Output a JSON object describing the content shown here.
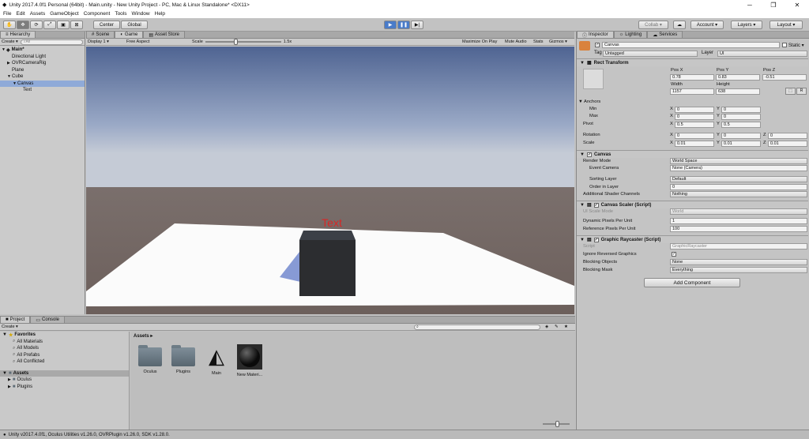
{
  "window": {
    "title": "Unity 2017.4.0f1 Personal (64bit) - Main.unity - New Unity Project - PC, Mac & Linux Standalone* <DX11>",
    "min": "─",
    "max": "❐",
    "close": "✕"
  },
  "menu": [
    "File",
    "Edit",
    "Assets",
    "GameObject",
    "Component",
    "Tools",
    "Window",
    "Help"
  ],
  "toolbar": {
    "center": "Center",
    "global": "Global",
    "collab": "Collab ▾",
    "account": "Account ▾",
    "layers": "Layers ▾",
    "layout": "Layout ▾"
  },
  "hierarchy": {
    "tab": "Hierarchy",
    "create": "Create ▾",
    "search_placeholder": "All",
    "items": [
      {
        "label": "Main*",
        "indent": 0,
        "arrow": "▼"
      },
      {
        "label": "Directional Light",
        "indent": 1,
        "arrow": ""
      },
      {
        "label": "OVRCameraRig",
        "indent": 1,
        "arrow": "▶"
      },
      {
        "label": "Plane",
        "indent": 1,
        "arrow": ""
      },
      {
        "label": "Cube",
        "indent": 1,
        "arrow": "▼"
      },
      {
        "label": "Canvas",
        "indent": 2,
        "arrow": "▼"
      },
      {
        "label": "Text",
        "indent": 3,
        "arrow": ""
      }
    ]
  },
  "views": {
    "tabs": [
      "Scene",
      "Game",
      "Asset Store"
    ],
    "display": "Display 1 ▾",
    "aspect": "Free Aspect",
    "scale_label": "Scale",
    "scale_value": "1.5x",
    "maximize": "Maximize On Play",
    "mute": "Mute Audio",
    "stats": "Stats",
    "gizmos": "Gizmos ▾",
    "world_text": "Text"
  },
  "inspector": {
    "tabs": [
      "Inspector",
      "Lighting",
      "Services"
    ],
    "object_name": "Canvas",
    "static_label": "Static ▾",
    "tag_label": "Tag",
    "tag_value": "Untagged",
    "layer_label": "Layer",
    "layer_value": "UI",
    "rect_transform": {
      "title": "Rect Transform",
      "posx_label": "Pos X",
      "posy_label": "Pos Y",
      "posz_label": "Pos Z",
      "posx": "0.78",
      "posy": "0.83",
      "posz": "-0.51",
      "width_label": "Width",
      "height_label": "Height",
      "width": "1157",
      "height": "638",
      "anchors": "Anchors",
      "min": "Min",
      "max": "Max",
      "min_x": "0",
      "min_y": "0",
      "max_x": "0",
      "max_y": "0",
      "pivot": "Pivot",
      "pivot_x": "0.5",
      "pivot_y": "0.5",
      "rotation": "Rotation",
      "rot_x": "0",
      "rot_y": "0",
      "rot_z": "0",
      "scale": "Scale",
      "scale_x": "0.01",
      "scale_y": "0.01",
      "scale_z": "0.01",
      "x": "X",
      "y": "Y",
      "z": "Z",
      "r": "R"
    },
    "canvas": {
      "title": "Canvas",
      "render_mode_label": "Render Mode",
      "render_mode": "World Space",
      "event_camera_label": "Event Camera",
      "event_camera": "None (Camera)",
      "sorting_layer_label": "Sorting Layer",
      "sorting_layer": "Default",
      "order_label": "Order in Layer",
      "order": "0",
      "shader_label": "Additional Shader Channels",
      "shader": "Nothing"
    },
    "scaler": {
      "title": "Canvas Scaler (Script)",
      "mode_label": "UI Scale Mode",
      "mode": "World",
      "dppu_label": "Dynamic Pixels Per Unit",
      "dppu": "1",
      "rppu_label": "Reference Pixels Per Unit",
      "rppu": "100"
    },
    "raycaster": {
      "title": "Graphic Raycaster (Script)",
      "script_label": "Script",
      "script": "GraphicRaycaster",
      "ignore_label": "Ignore Reversed Graphics",
      "ignore": "✓",
      "blocking_label": "Blocking Objects",
      "blocking": "None",
      "mask_label": "Blocking Mask",
      "mask": "Everything"
    },
    "add_component": "Add Component"
  },
  "project": {
    "tabs": [
      "Project",
      "Console"
    ],
    "create": "Create ▾",
    "favorites": "Favorites",
    "fav_items": [
      "All Materials",
      "All Models",
      "All Prefabs",
      "All Conflicted"
    ],
    "assets_root": "Assets",
    "asset_folders": [
      "Oculus",
      "Plugins"
    ],
    "breadcrumb": "Assets ▸",
    "items": [
      {
        "label": "Oculus",
        "kind": "folder"
      },
      {
        "label": "Plugins",
        "kind": "folder"
      },
      {
        "label": "Main",
        "kind": "unity"
      },
      {
        "label": "New Materi...",
        "kind": "sphere"
      }
    ]
  },
  "status": "Unity v2017.4.0f1, Oculus Utilities v1.26.0, OVRPlugin v1.26.0, SDK v1.28.0."
}
